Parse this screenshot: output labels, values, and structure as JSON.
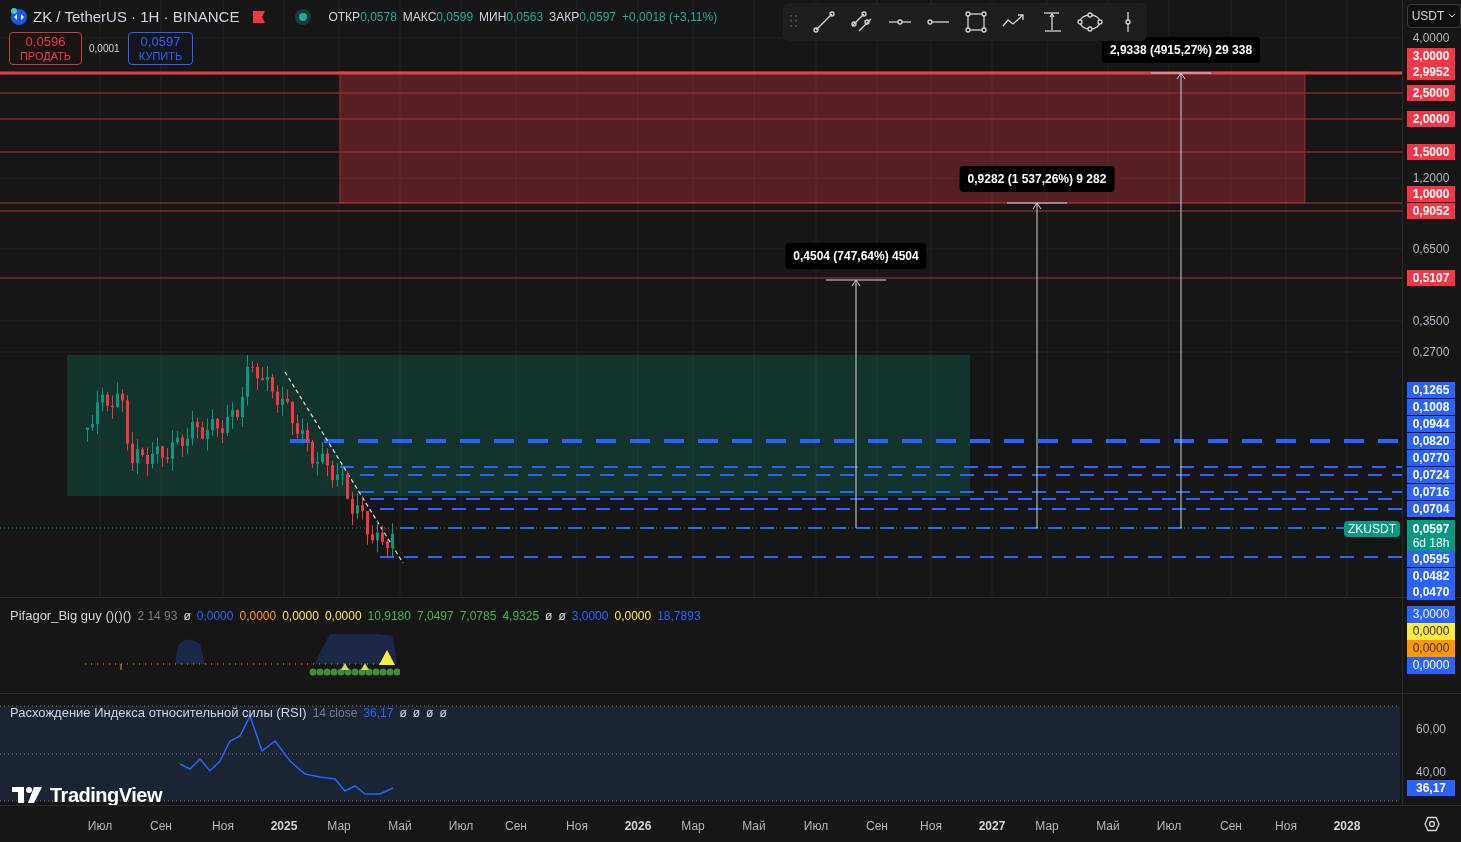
{
  "header": {
    "symbol": "ZK / TetherUS · 1H · BINANCE",
    "ohlc": [
      {
        "label": "ОТКР",
        "value": "0,0578"
      },
      {
        "label": "МАКС",
        "value": "0,0599"
      },
      {
        "label": "МИН",
        "value": "0,0563"
      },
      {
        "label": "ЗАКР",
        "value": "0,0597"
      }
    ],
    "change": "+0,0018 (+3,11%)"
  },
  "trade": {
    "sell": {
      "price": "0,0596",
      "label": "ПРОДАТЬ"
    },
    "spread": "0,0001",
    "buy": {
      "price": "0,0597",
      "label": "КУПИТЬ"
    }
  },
  "currency": "USDT",
  "measures": [
    "0,4504 (747,64%) 4504",
    "0,9282 (1 537,26%) 9 282",
    "2,9338 (4915,27%) 29 338"
  ],
  "price_axis": [
    {
      "text": "4,0000",
      "kind": "grid"
    },
    {
      "text": "3,0000",
      "kind": "red"
    },
    {
      "text": "2,9952",
      "kind": "red"
    },
    {
      "text": "2,5000",
      "kind": "red"
    },
    {
      "text": "2,0000",
      "kind": "red"
    },
    {
      "text": "1,5000",
      "kind": "red"
    },
    {
      "text": "1,2000",
      "kind": "grid"
    },
    {
      "text": "1,0000",
      "kind": "red"
    },
    {
      "text": "0,9052",
      "kind": "red"
    },
    {
      "text": "0,6500",
      "kind": "grid"
    },
    {
      "text": "0,5107",
      "kind": "red"
    },
    {
      "text": "0,3500",
      "kind": "grid"
    },
    {
      "text": "0,2700",
      "kind": "grid"
    },
    {
      "text": "0,1265",
      "kind": "blue"
    },
    {
      "text": "0,1008",
      "kind": "blue"
    },
    {
      "text": "0,0944",
      "kind": "blue"
    },
    {
      "text": "0,0820",
      "kind": "blue"
    },
    {
      "text": "0,0770",
      "kind": "blue"
    },
    {
      "text": "0,0724",
      "kind": "blue"
    },
    {
      "text": "0,0716",
      "kind": "blue"
    },
    {
      "text": "0,0704",
      "kind": "blue"
    },
    {
      "text": "0,0595",
      "kind": "blue"
    },
    {
      "text": "0,0482",
      "kind": "blue"
    },
    {
      "text": "0,0470",
      "kind": "blue"
    }
  ],
  "symbol_tag": "ZKUSDT",
  "current_price": {
    "price": "0,0597",
    "countdown": "6d 18h"
  },
  "indicator": {
    "name": "Pifagor_Big guy ()()()",
    "params": "2 14 93",
    "values": [
      {
        "text": "ø",
        "color": "#d1d4dc"
      },
      {
        "text": "0,0000",
        "color": "#2962ff"
      },
      {
        "text": "0,0000",
        "color": "#ff9800"
      },
      {
        "text": "0,0000",
        "color": "#ffeb3b"
      },
      {
        "text": "0,0000",
        "color": "#ffeb3b"
      },
      {
        "text": "10,9180",
        "color": "#4caf50"
      },
      {
        "text": "7,0497",
        "color": "#4caf50"
      },
      {
        "text": "7,0785",
        "color": "#4caf50"
      },
      {
        "text": "4,9325",
        "color": "#4caf50"
      },
      {
        "text": "ø",
        "color": "#d1d4dc"
      },
      {
        "text": "ø",
        "color": "#d1d4dc"
      },
      {
        "text": "3,0000",
        "color": "#2962ff"
      },
      {
        "text": "0,0000",
        "color": "#ffeb3b"
      },
      {
        "text": "18,7893",
        "color": "#2962ff"
      }
    ],
    "axis": [
      {
        "text": "3,0000",
        "color": "#2962ff"
      },
      {
        "text": "0,0000",
        "color": "#ffeb3b"
      },
      {
        "text": "0,0000",
        "color": "#ff9800"
      },
      {
        "text": "0,0000",
        "color": "#2962ff"
      }
    ]
  },
  "rsi": {
    "name": "Расхождение Индекса относительной силы (RSI)",
    "params": "14 close",
    "values": [
      {
        "text": "36,17",
        "color": "#2962ff"
      },
      {
        "text": "ø",
        "color": "#d1d4dc"
      },
      {
        "text": "ø",
        "color": "#d1d4dc"
      },
      {
        "text": "ø",
        "color": "#d1d4dc"
      },
      {
        "text": "ø",
        "color": "#d1d4dc"
      }
    ],
    "axis": [
      "60,00",
      "40,00"
    ],
    "current": "36,17"
  },
  "logo": "TradingView",
  "time_axis": [
    {
      "text": "Июл",
      "kind": "month"
    },
    {
      "text": "Сен",
      "kind": "month"
    },
    {
      "text": "Ноя",
      "kind": "month"
    },
    {
      "text": "2025",
      "kind": "year"
    },
    {
      "text": "Мар",
      "kind": "month"
    },
    {
      "text": "Май",
      "kind": "month"
    },
    {
      "text": "Июл",
      "kind": "month"
    },
    {
      "text": "Сен",
      "kind": "month"
    },
    {
      "text": "Ноя",
      "kind": "month"
    },
    {
      "text": "2026",
      "kind": "year"
    },
    {
      "text": "Мар",
      "kind": "month"
    },
    {
      "text": "Май",
      "kind": "month"
    },
    {
      "text": "Июл",
      "kind": "month"
    },
    {
      "text": "Сен",
      "kind": "month"
    },
    {
      "text": "Ноя",
      "kind": "month"
    },
    {
      "text": "2027",
      "kind": "year"
    },
    {
      "text": "Мар",
      "kind": "month"
    },
    {
      "text": "Май",
      "kind": "month"
    },
    {
      "text": "Июл",
      "kind": "month"
    },
    {
      "text": "Сен",
      "kind": "month"
    },
    {
      "text": "Ноя",
      "kind": "month"
    },
    {
      "text": "2028",
      "kind": "year"
    }
  ]
}
